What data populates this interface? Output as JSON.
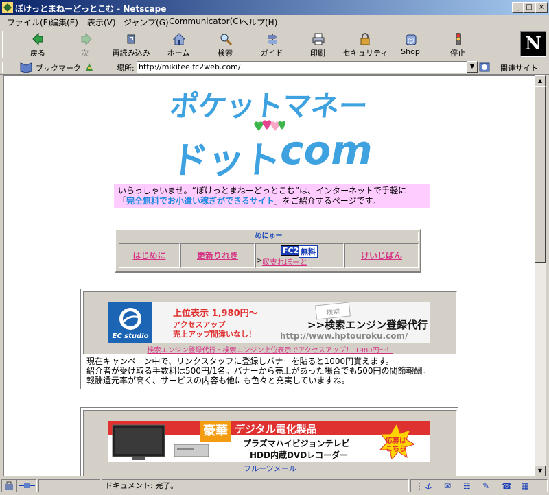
{
  "window": {
    "title": "ぽけっとまねーどっとこむ - Netscape",
    "controls": {
      "minimize": "_",
      "maximize": "□",
      "close": "×"
    }
  },
  "menubar": [
    "ファイル(F)",
    "編集(E)",
    "表示(V)",
    "ジャンプ(G)",
    "Communicator(C)",
    "ヘルプ(H)"
  ],
  "toolbar": {
    "buttons": [
      {
        "label": "戻る",
        "icon": "back-arrow-icon",
        "enabled": true
      },
      {
        "label": "次",
        "icon": "forward-arrow-icon",
        "enabled": false
      },
      {
        "label": "再読み込み",
        "icon": "reload-icon",
        "enabled": true
      },
      {
        "label": "ホーム",
        "icon": "home-icon",
        "enabled": true
      },
      {
        "label": "検索",
        "icon": "search-icon",
        "enabled": true
      },
      {
        "label": "ガイド",
        "icon": "guide-icon",
        "enabled": true
      },
      {
        "label": "印刷",
        "icon": "print-icon",
        "enabled": true
      },
      {
        "label": "セキュリティ",
        "icon": "lock-icon",
        "enabled": true
      },
      {
        "label": "Shop",
        "icon": "shop-icon",
        "enabled": true
      },
      {
        "label": "停止",
        "icon": "stop-icon",
        "enabled": true
      }
    ],
    "brand": "N"
  },
  "locationbar": {
    "bookmarks_label": "ブックマーク",
    "location_label": "場所:",
    "url": "http://mikitee.fc2web.com/",
    "related_label": "関連サイト"
  },
  "page": {
    "logo": {
      "line1": "ポケットマネー",
      "line2a": "ドット",
      "line2b": "com"
    },
    "intro": {
      "line1": "いらっしゃいませ。“ぽけっとまねーどっとこむ”は、インターネットで手軽に",
      "line2_pre": "「",
      "line2_highlight": "完全無料でお小遣い稼ぎができるサイト",
      "line2_post": "」をご紹介するページです。"
    },
    "menu": {
      "header": "めにゅー",
      "items": [
        "はじめに",
        "更新りれき",
        "収支れぽーと",
        "けいじばん"
      ],
      "fc2_badge": "FC2",
      "free_badge": "無料",
      "arrow": ">"
    },
    "ad1": {
      "banner": {
        "brand": "EC studio",
        "price_line": "上位表示 1,980円～",
        "line2": "アクセスアップ",
        "line3": "売上アップ間違いなし！",
        "search_tag": "検索",
        "headline": ">>検索エンジン登録代行",
        "url": "http://www.hptouroku.com/"
      },
      "link": "検索エンジン登録代行・検索エンジン上位表示でアクセスアップ！ 1980円～！",
      "desc": [
        "現在キャンペーン中で、リンクスタッフに登録しバナーを貼ると1000円貰えます。",
        "紹介者が受け取る手数料は500円/1名。バナーから売上があった場合でも500円の閲節報酬。",
        "報酬還元率が高く、サービスの内容も他にも色々と充実していますね。"
      ]
    },
    "ad2": {
      "banner": {
        "badge": "豪華",
        "title": "デジタル電化製品",
        "line1": "プラズマハイビジョンテレビ",
        "line2": "HDD内蔵DVDレコーダー",
        "burst_line1": "応募は",
        "burst_line2": "こちら"
      },
      "link": "フルーツメール"
    }
  },
  "status": {
    "text": "ドキュメント: 完了。"
  },
  "colors": {
    "titlebar": "#0a246a",
    "link": "#d63384",
    "logo": "#3fa2e0",
    "intro_bg": "#ffccff"
  }
}
